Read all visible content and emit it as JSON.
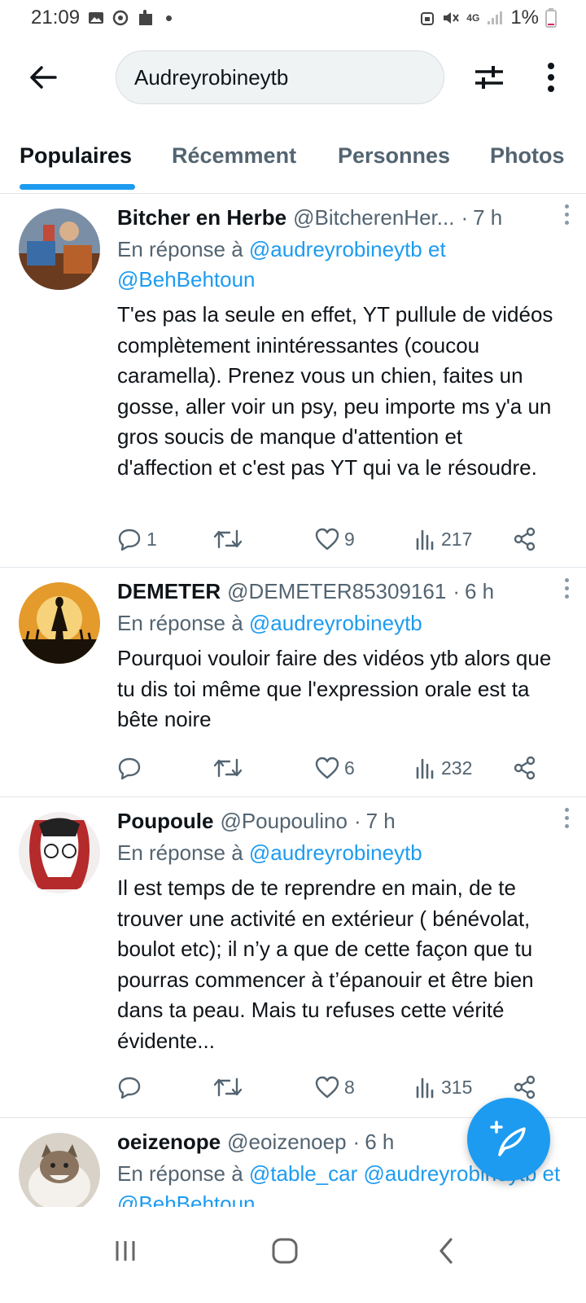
{
  "status_bar": {
    "time": "21:09",
    "network": "4G",
    "battery": "1%"
  },
  "header": {
    "search_value": "Audreyrobineytb"
  },
  "tabs": [
    {
      "label": "Populaires",
      "active": true
    },
    {
      "label": "Récemment",
      "active": false
    },
    {
      "label": "Personnes",
      "active": false
    },
    {
      "label": "Photos",
      "active": false
    }
  ],
  "tweets": [
    {
      "name": "Bitcher en Herbe",
      "handle": "@BitcherenHer...",
      "sep": "·",
      "time": "7 h",
      "reply_prefix": "En réponse à",
      "reply_mentions": "@audreyrobineytb et @BehBehtoun",
      "text": "T'es pas la seule en effet, YT pullule de vidéos complètement inintéressantes (coucou caramella). Prenez vous un chien, faites un gosse, aller voir un psy, peu importe ms y'a un gros soucis de manque d'attention et d'affection et c'est pas YT qui va le résoudre.",
      "replies": "1",
      "retweets": "",
      "likes": "9",
      "views": "217"
    },
    {
      "name": "DEMETER",
      "handle": "@DEMETER85309161",
      "sep": "·",
      "time": "6 h",
      "reply_prefix": "En réponse à",
      "reply_mentions": "@audreyrobineytb",
      "text": "Pourquoi vouloir faire des vidéos ytb alors que tu dis toi même que l'expression orale est ta bête noire",
      "replies": "",
      "retweets": "",
      "likes": "6",
      "views": "232"
    },
    {
      "name": "Poupoule",
      "handle": "@Poupoulino",
      "sep": "·",
      "time": "7 h",
      "reply_prefix": "En réponse à",
      "reply_mentions": "@audreyrobineytb",
      "text": "Il est temps de te reprendre en main, de te trouver une activité en extérieur ( bénévolat, boulot etc); il n’y a que de cette façon que tu pourras commencer à t’épanouir et être bien dans ta peau. Mais tu refuses cette vérité évidente...",
      "replies": "",
      "retweets": "",
      "likes": "8",
      "views": "315"
    },
    {
      "name": "oeizenope",
      "handle": "@eoizenoep",
      "sep": "·",
      "time": "6 h",
      "reply_prefix": "En réponse à",
      "reply_mentions": "@table_car @audreyrobineytb et @BehBehtoun"
    }
  ],
  "colors": {
    "accent": "#1d9bf0",
    "text": "#0f1419",
    "muted": "#536471"
  }
}
